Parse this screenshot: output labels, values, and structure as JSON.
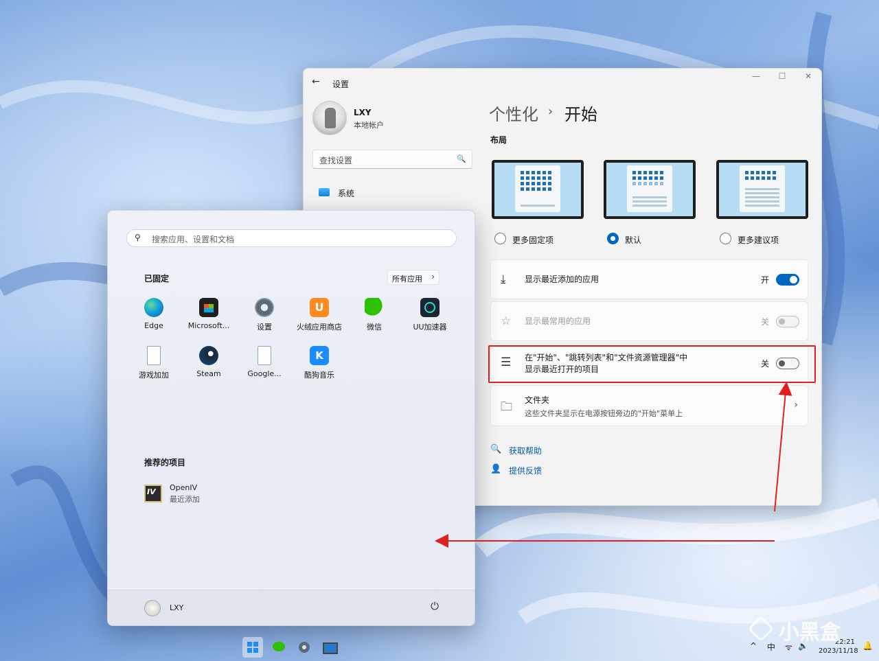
{
  "settings": {
    "title": "设置",
    "window_controls": {
      "min": "—",
      "max": "☐",
      "close": "✕"
    },
    "profile": {
      "name": "LXY",
      "account_type": "本地帐户"
    },
    "search_placeholder": "查找设置",
    "nav": {
      "system": "系统"
    },
    "breadcrumb": {
      "parent": "个性化",
      "separator": "›",
      "current": "开始"
    },
    "layout_heading": "布局",
    "layout_options": [
      {
        "label": "更多固定项",
        "selected": false
      },
      {
        "label": "默认",
        "selected": true
      },
      {
        "label": "更多建议项",
        "selected": false
      }
    ],
    "rows": [
      {
        "label": "显示最近添加的应用",
        "state": "开",
        "toggle": "on"
      },
      {
        "label": "显示最常用的应用",
        "state": "关",
        "toggle": "disabled"
      },
      {
        "label_line1": "在\"开始\"、\"跳转列表\"和\"文件资源管理器\"中",
        "label_line2": "显示最近打开的项目",
        "state": "关",
        "toggle": "off"
      },
      {
        "label": "文件夹",
        "sublabel": "这些文件夹显示在电源按钮旁边的\"开始\"菜单上"
      }
    ],
    "links": {
      "help": "获取帮助",
      "feedback": "提供反馈"
    }
  },
  "start_menu": {
    "search_placeholder": "搜索应用、设置和文档",
    "pinned_title": "已固定",
    "all_apps": "所有应用",
    "pinned": [
      {
        "label": "Edge",
        "icon": "edge-icon"
      },
      {
        "label": "Microsoft...",
        "icon": "microsoft-store-icon"
      },
      {
        "label": "设置",
        "icon": "settings-gear-icon"
      },
      {
        "label": "火绒应用商店",
        "icon": "huorong-store-icon"
      },
      {
        "label": "微信",
        "icon": "wechat-icon"
      },
      {
        "label": "UU加速器",
        "icon": "uu-accelerator-icon"
      },
      {
        "label": "游戏加加",
        "icon": "file-icon"
      },
      {
        "label": "Steam",
        "icon": "steam-icon"
      },
      {
        "label": "Google...",
        "icon": "file-icon"
      },
      {
        "label": "酷狗音乐",
        "icon": "kugou-icon"
      }
    ],
    "recommended_title": "推荐的项目",
    "recommended": [
      {
        "name": "OpenIV",
        "sub": "最近添加"
      }
    ],
    "user": "LXY"
  },
  "taskbar": {
    "tray": {
      "chevron": "^",
      "ime": "中",
      "time": "22:21",
      "date": "2023/11/18"
    }
  },
  "watermark": "小黑盒",
  "colors": {
    "accent": "#0067c0",
    "annotation": "#e02020",
    "link": "#0a5aa8"
  }
}
